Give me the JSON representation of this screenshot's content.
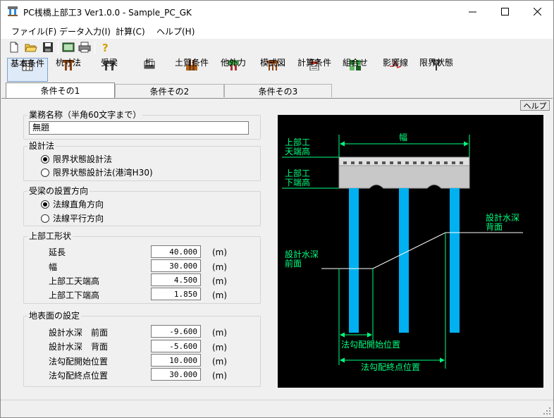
{
  "window": {
    "title": "PC桟橋上部工3 Ver1.0.0 - Sample_PC_GK"
  },
  "menu": [
    "ファイル(F)",
    "データ入力(I)",
    "計算(C)",
    "ヘルプ(H)"
  ],
  "toolbar2": [
    {
      "label": "基本条件",
      "icon": "grid-icon"
    },
    {
      "label": "杭寸法",
      "icon": "pile-icon"
    },
    {
      "label": "受梁",
      "icon": "beam-icon"
    },
    {
      "label": "桁",
      "icon": "girder-icon"
    },
    {
      "label": "土質条件",
      "icon": "soil-icon"
    },
    {
      "label": "他外力",
      "icon": "force-icon"
    },
    {
      "label": "模式図",
      "icon": "diagram-icon"
    },
    {
      "label": "計算条件",
      "icon": "calc-icon"
    },
    {
      "label": "組合せ",
      "icon": "combo-icon"
    },
    {
      "label": "影響線",
      "icon": "influence-icon"
    },
    {
      "label": "限界状態",
      "icon": "limit-icon"
    }
  ],
  "tabs": [
    "条件その1",
    "条件その2",
    "条件その3"
  ],
  "help_label": "ヘルプ",
  "form": {
    "job_title": "業務名称（半角60文字まで）",
    "job_value": "無題",
    "design_method_title": "設計法",
    "design_method_options": [
      "限界状態設計法",
      "限界状態設計法(港湾H30)"
    ],
    "beam_dir_title": "受梁の設置方向",
    "beam_dir_options": [
      "法線直角方向",
      "法線平行方向"
    ],
    "shape_title": "上部工形状",
    "shape_rows": [
      {
        "label": "延長",
        "value": "40.000",
        "unit": "(m)"
      },
      {
        "label": "幅",
        "value": "30.000",
        "unit": "(m)"
      },
      {
        "label": "上部工天端高",
        "value": "4.500",
        "unit": "(m)"
      },
      {
        "label": "上部工下端高",
        "value": "1.850",
        "unit": "(m)"
      }
    ],
    "ground_title": "地表面の設定",
    "ground_rows": [
      {
        "label": "設計水深　前面",
        "value": "-9.600",
        "unit": "(m)"
      },
      {
        "label": "設計水深　背面",
        "value": "-5.600",
        "unit": "(m)"
      },
      {
        "label": "法勾配開始位置",
        "value": "10.000",
        "unit": "(m)"
      },
      {
        "label": "法勾配終点位置",
        "value": "30.000",
        "unit": "(m)"
      }
    ]
  },
  "diagram": {
    "width_label": "幅",
    "top_label": [
      "上部工",
      "天端高"
    ],
    "bottom_label": [
      "上部工",
      "下端高"
    ],
    "front_label": [
      "設計水深",
      "前面"
    ],
    "back_label": [
      "設計水深",
      "背面"
    ],
    "slope_start": "法勾配開始位置",
    "slope_end": "法勾配終点位置"
  },
  "colors": {
    "diagram_bg": "#000000",
    "diagram_fg": "#00ff7f",
    "pile": "#00b0f0",
    "deck": "#c8c8c8"
  }
}
